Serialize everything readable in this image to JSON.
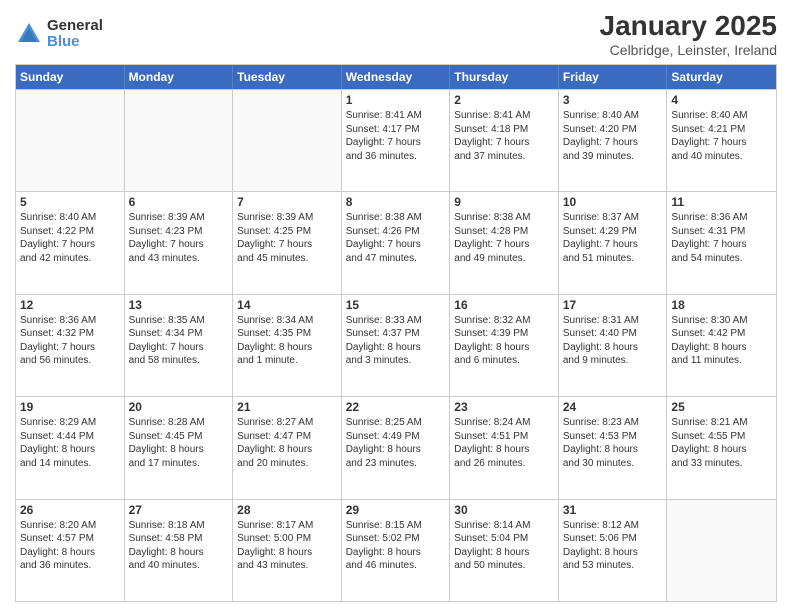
{
  "header": {
    "logo_general": "General",
    "logo_blue": "Blue",
    "month_title": "January 2025",
    "location": "Celbridge, Leinster, Ireland"
  },
  "days_of_week": [
    "Sunday",
    "Monday",
    "Tuesday",
    "Wednesday",
    "Thursday",
    "Friday",
    "Saturday"
  ],
  "weeks": [
    [
      {
        "day": "",
        "info": ""
      },
      {
        "day": "",
        "info": ""
      },
      {
        "day": "",
        "info": ""
      },
      {
        "day": "1",
        "info": "Sunrise: 8:41 AM\nSunset: 4:17 PM\nDaylight: 7 hours\nand 36 minutes."
      },
      {
        "day": "2",
        "info": "Sunrise: 8:41 AM\nSunset: 4:18 PM\nDaylight: 7 hours\nand 37 minutes."
      },
      {
        "day": "3",
        "info": "Sunrise: 8:40 AM\nSunset: 4:20 PM\nDaylight: 7 hours\nand 39 minutes."
      },
      {
        "day": "4",
        "info": "Sunrise: 8:40 AM\nSunset: 4:21 PM\nDaylight: 7 hours\nand 40 minutes."
      }
    ],
    [
      {
        "day": "5",
        "info": "Sunrise: 8:40 AM\nSunset: 4:22 PM\nDaylight: 7 hours\nand 42 minutes."
      },
      {
        "day": "6",
        "info": "Sunrise: 8:39 AM\nSunset: 4:23 PM\nDaylight: 7 hours\nand 43 minutes."
      },
      {
        "day": "7",
        "info": "Sunrise: 8:39 AM\nSunset: 4:25 PM\nDaylight: 7 hours\nand 45 minutes."
      },
      {
        "day": "8",
        "info": "Sunrise: 8:38 AM\nSunset: 4:26 PM\nDaylight: 7 hours\nand 47 minutes."
      },
      {
        "day": "9",
        "info": "Sunrise: 8:38 AM\nSunset: 4:28 PM\nDaylight: 7 hours\nand 49 minutes."
      },
      {
        "day": "10",
        "info": "Sunrise: 8:37 AM\nSunset: 4:29 PM\nDaylight: 7 hours\nand 51 minutes."
      },
      {
        "day": "11",
        "info": "Sunrise: 8:36 AM\nSunset: 4:31 PM\nDaylight: 7 hours\nand 54 minutes."
      }
    ],
    [
      {
        "day": "12",
        "info": "Sunrise: 8:36 AM\nSunset: 4:32 PM\nDaylight: 7 hours\nand 56 minutes."
      },
      {
        "day": "13",
        "info": "Sunrise: 8:35 AM\nSunset: 4:34 PM\nDaylight: 7 hours\nand 58 minutes."
      },
      {
        "day": "14",
        "info": "Sunrise: 8:34 AM\nSunset: 4:35 PM\nDaylight: 8 hours\nand 1 minute."
      },
      {
        "day": "15",
        "info": "Sunrise: 8:33 AM\nSunset: 4:37 PM\nDaylight: 8 hours\nand 3 minutes."
      },
      {
        "day": "16",
        "info": "Sunrise: 8:32 AM\nSunset: 4:39 PM\nDaylight: 8 hours\nand 6 minutes."
      },
      {
        "day": "17",
        "info": "Sunrise: 8:31 AM\nSunset: 4:40 PM\nDaylight: 8 hours\nand 9 minutes."
      },
      {
        "day": "18",
        "info": "Sunrise: 8:30 AM\nSunset: 4:42 PM\nDaylight: 8 hours\nand 11 minutes."
      }
    ],
    [
      {
        "day": "19",
        "info": "Sunrise: 8:29 AM\nSunset: 4:44 PM\nDaylight: 8 hours\nand 14 minutes."
      },
      {
        "day": "20",
        "info": "Sunrise: 8:28 AM\nSunset: 4:45 PM\nDaylight: 8 hours\nand 17 minutes."
      },
      {
        "day": "21",
        "info": "Sunrise: 8:27 AM\nSunset: 4:47 PM\nDaylight: 8 hours\nand 20 minutes."
      },
      {
        "day": "22",
        "info": "Sunrise: 8:25 AM\nSunset: 4:49 PM\nDaylight: 8 hours\nand 23 minutes."
      },
      {
        "day": "23",
        "info": "Sunrise: 8:24 AM\nSunset: 4:51 PM\nDaylight: 8 hours\nand 26 minutes."
      },
      {
        "day": "24",
        "info": "Sunrise: 8:23 AM\nSunset: 4:53 PM\nDaylight: 8 hours\nand 30 minutes."
      },
      {
        "day": "25",
        "info": "Sunrise: 8:21 AM\nSunset: 4:55 PM\nDaylight: 8 hours\nand 33 minutes."
      }
    ],
    [
      {
        "day": "26",
        "info": "Sunrise: 8:20 AM\nSunset: 4:57 PM\nDaylight: 8 hours\nand 36 minutes."
      },
      {
        "day": "27",
        "info": "Sunrise: 8:18 AM\nSunset: 4:58 PM\nDaylight: 8 hours\nand 40 minutes."
      },
      {
        "day": "28",
        "info": "Sunrise: 8:17 AM\nSunset: 5:00 PM\nDaylight: 8 hours\nand 43 minutes."
      },
      {
        "day": "29",
        "info": "Sunrise: 8:15 AM\nSunset: 5:02 PM\nDaylight: 8 hours\nand 46 minutes."
      },
      {
        "day": "30",
        "info": "Sunrise: 8:14 AM\nSunset: 5:04 PM\nDaylight: 8 hours\nand 50 minutes."
      },
      {
        "day": "31",
        "info": "Sunrise: 8:12 AM\nSunset: 5:06 PM\nDaylight: 8 hours\nand 53 minutes."
      },
      {
        "day": "",
        "info": ""
      }
    ]
  ]
}
